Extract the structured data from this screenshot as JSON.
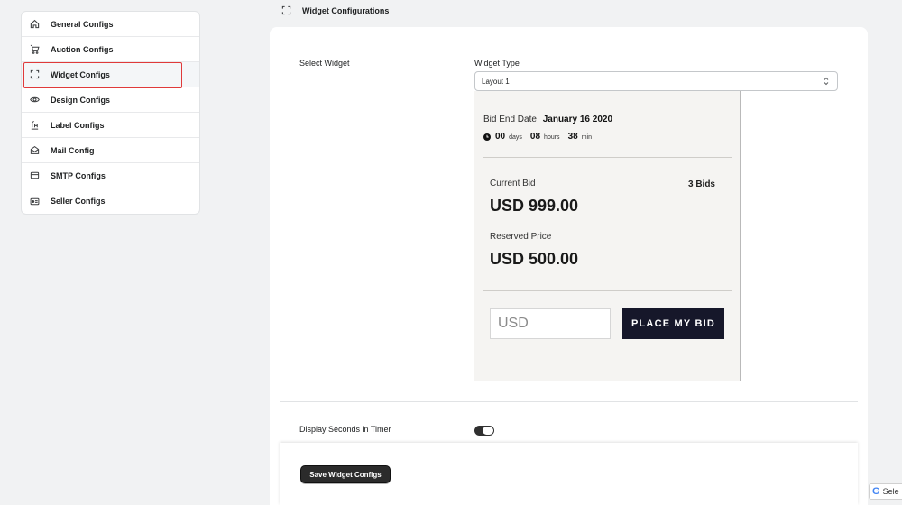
{
  "sidebar": {
    "items": [
      {
        "label": "General Configs",
        "icon": "home-icon"
      },
      {
        "label": "Auction Configs",
        "icon": "cart-icon"
      },
      {
        "label": "Widget Configs",
        "icon": "widget-frame-icon",
        "active": true
      },
      {
        "label": "Design Configs",
        "icon": "eye-icon"
      },
      {
        "label": "Label Configs",
        "icon": "label-icon"
      },
      {
        "label": "Mail Config",
        "icon": "mail-icon"
      },
      {
        "label": "SMTP Configs",
        "icon": "smtp-icon"
      },
      {
        "label": "Seller Configs",
        "icon": "seller-card-icon"
      }
    ]
  },
  "header": {
    "title": "Widget Configurations",
    "icon": "widget-frame-icon"
  },
  "form": {
    "select_widget_label": "Select Widget",
    "widget_type_label": "Widget Type",
    "widget_type_value": "Layout 1",
    "display_seconds_label": "Display Seconds in Timer",
    "display_seconds_on": true,
    "save_label": "Save Widget Configs"
  },
  "preview": {
    "bid_end_label": "Bid End Date",
    "bid_end_date": "January 16 2020",
    "countdown": {
      "days": "00",
      "days_unit": "days",
      "hours": "08",
      "hours_unit": "hours",
      "min": "38",
      "min_unit": "min"
    },
    "current_bid_label": "Current Bid",
    "bids_count": "3 Bids",
    "current_bid_value": "USD 999.00",
    "reserved_label": "Reserved Price",
    "reserved_value": "USD 500.00",
    "bid_input_placeholder": "USD",
    "place_bid_label": "PLACE MY BID"
  },
  "translate_badge": {
    "text": "Sele"
  },
  "colors": {
    "accent_outline": "#e03a3a",
    "button_dark": "#16172a"
  }
}
